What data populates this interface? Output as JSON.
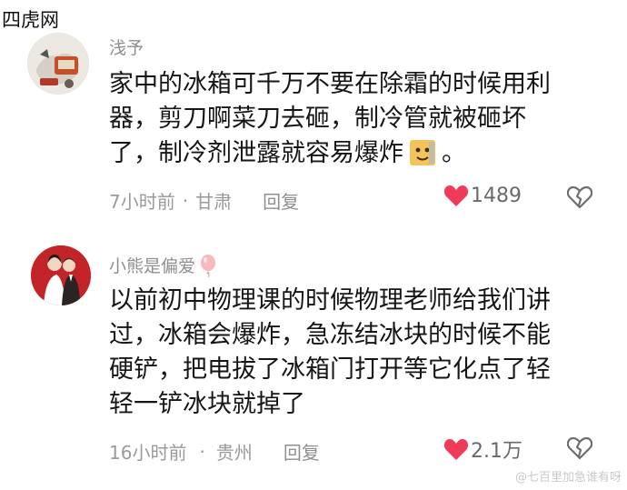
{
  "site_label": "四虎网",
  "comments": [
    {
      "username": "浅予",
      "content_lines": [
        "家中的冰箱可千万不要在除霜的时候用利",
        "器，剪刀啊菜刀去砸，制冷管就被砸坏",
        "了，制冷剂泄露就容易爆炸"
      ],
      "content_tail": "。",
      "time": "7小时前",
      "location": "甘肃",
      "reply_label": "回复",
      "like_count": "1489"
    },
    {
      "username": "小熊是偏爱",
      "content_lines": [
        "以前初中物理课的时候物理老师给我们讲",
        "过，冰箱会爆炸，急冻结冰块的时候不能",
        "硬铲，把电拔了冰箱门打开等它化点了轻",
        "轻一铲冰块就掉了"
      ],
      "time": "16小时前",
      "location": "贵州",
      "reply_label": "回复",
      "like_count": "2.1万"
    }
  ],
  "separator": "·",
  "watermark": "@七百里加急谁有呀",
  "colors": {
    "heart": "#f03a5a",
    "meta": "#9a9a9a",
    "text": "#161616"
  },
  "icons": [
    "heart-icon",
    "broken-heart-icon",
    "balloon-icon",
    "emoji-sticker-icon"
  ]
}
